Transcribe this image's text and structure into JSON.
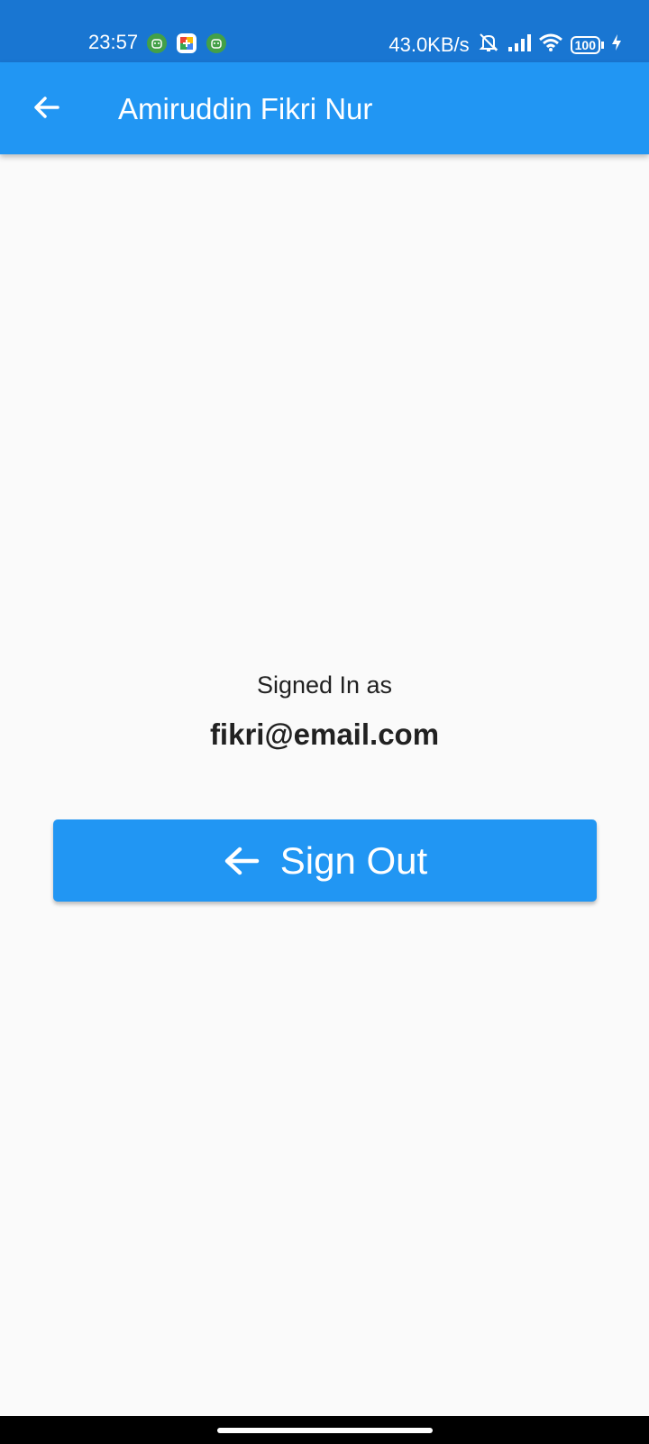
{
  "status_bar": {
    "time": "23:57",
    "network_speed": "43.0KB/s",
    "battery": "100",
    "background_color": "#1976d2",
    "notification_icons": [
      "android-app-icon",
      "colorful-app-icon",
      "android-app-icon"
    ],
    "status_icons": [
      "muted-bell-icon",
      "signal-icon",
      "wifi-icon",
      "battery-icon",
      "charging-icon"
    ]
  },
  "app_bar": {
    "title": "Amiruddin Fikri Nur",
    "back_icon": "arrow-back-icon",
    "color": "#2196f3"
  },
  "main": {
    "signed_in_label": "Signed In as",
    "email": "fikri@email.com",
    "sign_out_button": {
      "label": "Sign Out",
      "icon": "arrow-back-icon",
      "color": "#2196f3"
    }
  }
}
